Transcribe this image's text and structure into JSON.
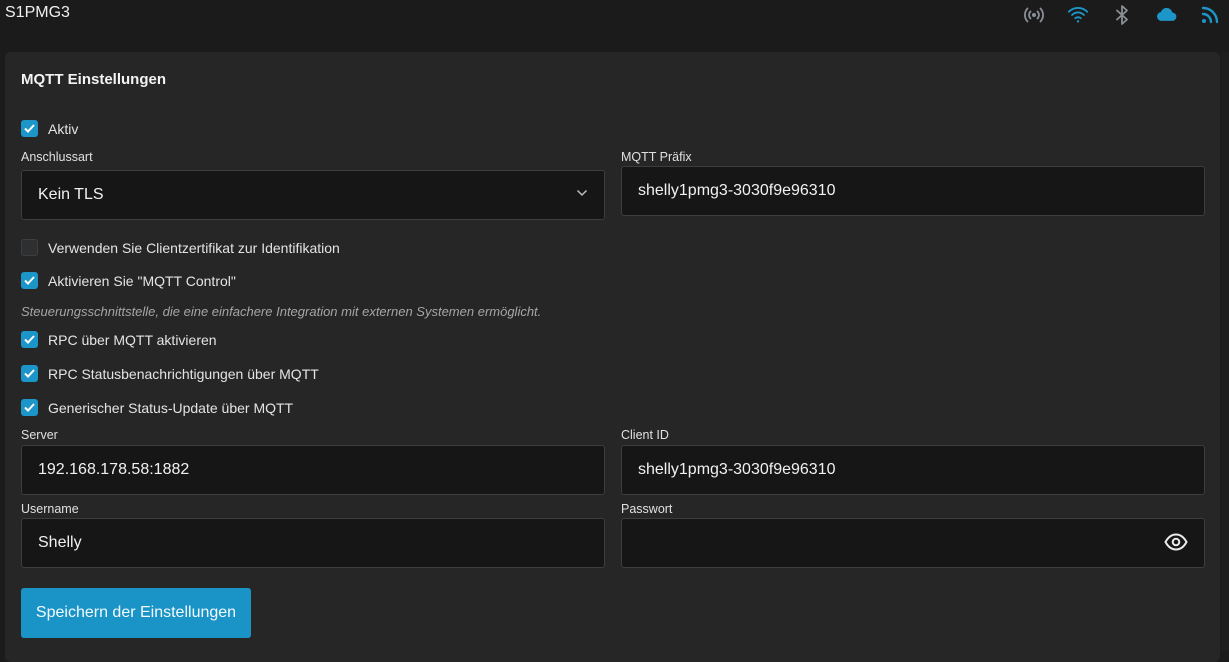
{
  "header": {
    "device_name": "S1PMG3",
    "icons": [
      "broadcast-icon",
      "wifi-icon",
      "bluetooth-icon",
      "cloud-icon",
      "rss-icon"
    ]
  },
  "colors": {
    "accent": "#1c95c9",
    "background": "#1b1b1c",
    "card": "#262627"
  },
  "card": {
    "title": "MQTT Einstellungen",
    "aktiv": {
      "label": "Aktiv",
      "checked": true
    },
    "connection_type": {
      "label": "Anschlussart",
      "value": "Kein TLS"
    },
    "mqtt_prefix": {
      "label": "MQTT Präfix",
      "value": "shelly1pmg3-3030f9e96310"
    },
    "client_cert": {
      "label": "Verwenden Sie Clientzertifikat zur Identifikation",
      "checked": false
    },
    "mqtt_control": {
      "label": "Aktivieren Sie \"MQTT Control\"",
      "checked": true
    },
    "mqtt_control_hint": "Steuerungsschnittstelle, die eine einfachere Integration mit externen Systemen ermöglicht.",
    "rpc_mqtt": {
      "label": "RPC über MQTT aktivieren",
      "checked": true
    },
    "rpc_status": {
      "label": "RPC Statusbenachrichtigungen über MQTT",
      "checked": true
    },
    "generic_status": {
      "label": "Generischer Status-Update über MQTT",
      "checked": true
    },
    "server": {
      "label": "Server",
      "value": "192.168.178.58:1882"
    },
    "client_id": {
      "label": "Client ID",
      "value": "shelly1pmg3-3030f9e96310"
    },
    "username": {
      "label": "Username",
      "value": "Shelly"
    },
    "password": {
      "label": "Passwort",
      "value": ""
    },
    "save_label": "Speichern der Einstellungen"
  }
}
